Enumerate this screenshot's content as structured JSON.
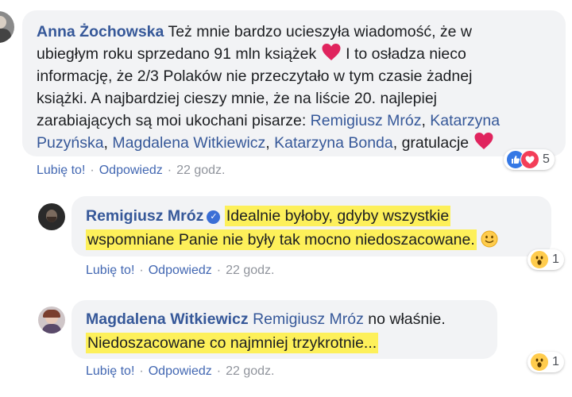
{
  "comment1": {
    "author": "Anna Żochowska",
    "text_part1": " Też mnie bardzo ucieszyła wiadomość, że w",
    "text_part2": "ubiegłym roku sprzedano 91 mln książek ",
    "text_part3": " I to osładza nieco",
    "text_part4": "informację, że 2/3 Polaków nie przeczytało w tym czasie żadnej",
    "text_part5": "książki. A najbardziej cieszy mnie, że na liście 20. najlepiej",
    "text_part6": "zarabiających są moi ukochani pisarze: ",
    "mention1": "Remigiusz Mróz",
    "comma": ",",
    "mention2a": " Katarzyna",
    "mention2b": "Puzyńska",
    "mention3": "Magdalena Witkiewicz",
    "mention4": "Katarzyna Bonda",
    "text_end": ", gratulacje ",
    "like": "Lubię to!",
    "reply": "Odpowiedz",
    "sep": "·",
    "time": "22 godz.",
    "reaction_count": "5",
    "reaction_icons": [
      "like-icon",
      "love-icon"
    ]
  },
  "reply1": {
    "author": "Remigiusz Mróz",
    "verified_icon": "verified-badge-icon",
    "line1": "Idealnie byłoby, gdyby wszystkie",
    "line2": "wspomniane Panie nie były tak mocno niedoszacowane.",
    "like": "Lubię to!",
    "reply": "Odpowiedz",
    "sep": "·",
    "time": "22 godz.",
    "reaction_count": "1",
    "reaction_icon": "wow-icon",
    "highlight_color": "#fdf05a"
  },
  "reply2": {
    "author": "Magdalena Witkiewicz",
    "mention": "Remigiusz Mróz",
    "text1": " no właśnie.",
    "line2": "Niedoszacowane co najmniej trzykrotnie...",
    "like": "Lubię to!",
    "reply": "Odpowiedz",
    "sep": "·",
    "time": "22 godz.",
    "reaction_count": "1",
    "reaction_icon": "wow-icon",
    "highlight_color": "#fdf05a"
  },
  "colors": {
    "link": "#365899",
    "action": "#4267b2",
    "bubble": "#f2f3f5",
    "muted": "#90949c"
  }
}
